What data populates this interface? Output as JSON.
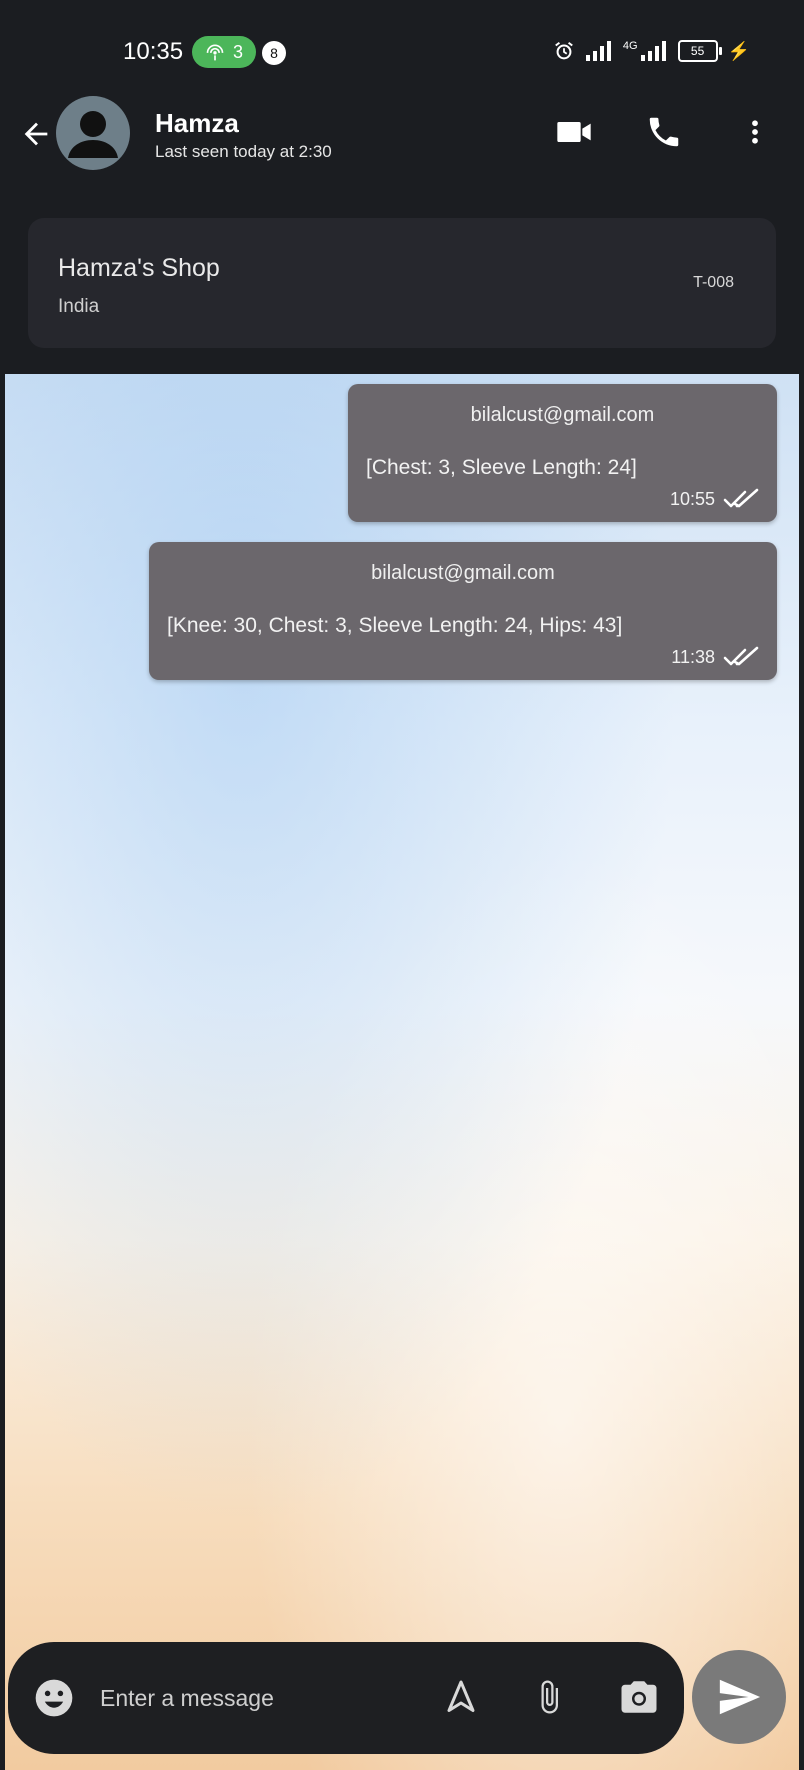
{
  "status_bar": {
    "time": "10:35",
    "hotspot_count": "3",
    "notification_count": "8",
    "network_label": "4G",
    "battery": "55"
  },
  "header": {
    "contact_name": "Hamza",
    "last_seen": "Last seen today at 2:30",
    "icons": [
      "back-arrow-icon",
      "avatar-person-icon",
      "video-call-icon",
      "phone-icon",
      "more-vert-icon"
    ]
  },
  "shop_card": {
    "name": "Hamza's Shop",
    "country": "India",
    "code": "T-008"
  },
  "messages": [
    {
      "sender": "bilalcust@gmail.com",
      "text": "[Chest: 3, Sleeve Length: 24]",
      "time": "10:55",
      "status": "read"
    },
    {
      "sender": "bilalcust@gmail.com",
      "text": "[Knee: 30, Chest: 3, Sleeve Length: 24, Hips: 43]",
      "time": "11:38",
      "status": "read"
    }
  ],
  "composer": {
    "placeholder": "Enter a message",
    "icons": [
      "emoji-icon",
      "location-arrow-icon",
      "attach-icon",
      "camera-icon",
      "send-icon"
    ]
  },
  "colors": {
    "app_bar": "#1b1d21",
    "bubble": "#6b676c",
    "hotspot": "#4cb65a",
    "send_button": "#7a7a7a"
  }
}
